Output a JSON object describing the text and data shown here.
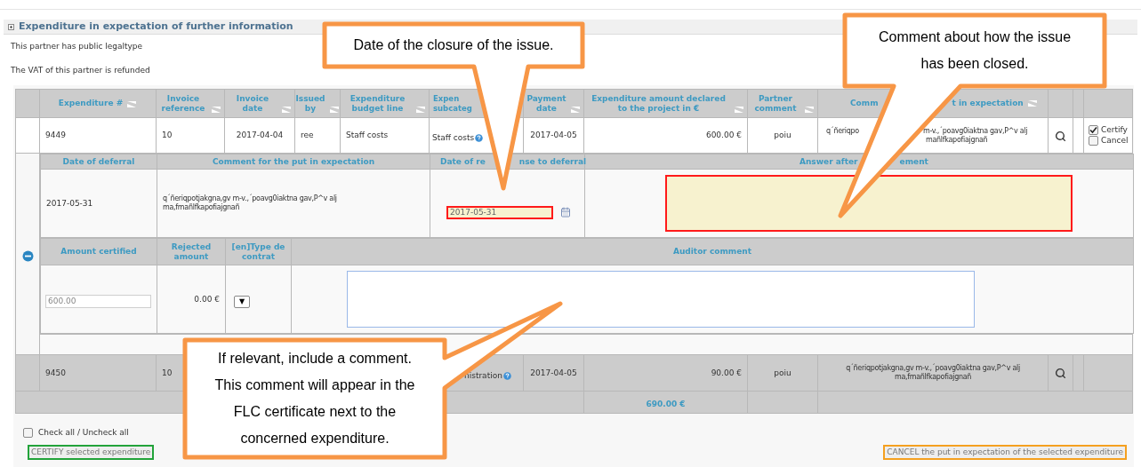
{
  "section": {
    "title": "Expenditure in expectation of further information",
    "expanded": true
  },
  "notes": [
    "This partner has public legaltype",
    "The VAT of this partner is refunded"
  ],
  "table": {
    "columns": [
      {
        "label": "Expenditure #",
        "sort_icon": true
      },
      {
        "label": "Invoice reference",
        "sort_icon": true
      },
      {
        "label": "Invoice date",
        "sort_icon": true
      },
      {
        "label": "Issued by",
        "sort_icon": true
      },
      {
        "label": "Expenditure budget line",
        "sort_icon": true
      },
      {
        "parts": [
          "Expen",
          "subcateg"
        ],
        "sort_icon": false
      },
      {
        "label": "Payment date",
        "sort_icon": true
      },
      {
        "label": "Expenditure amount declared to the project in €",
        "sort_icon": true
      },
      {
        "label": "Partner comment",
        "sort_icon": true
      },
      {
        "parts": [
          "Comm",
          "t in expectation"
        ],
        "sort_icon": true
      }
    ],
    "rows": [
      {
        "expenditure": "9449",
        "invoice_reference": "10",
        "invoice_date": "2017-04-04",
        "issued_by": "ree",
        "budget_line": "Staff costs",
        "subcategory": "Staff costs",
        "payment_date": "2017-04-05",
        "amount": "600.00 €",
        "partner_comment": "poiu",
        "comment_lines": [
          [
            "q´ñeriqpo",
            "m-v.,´poavg0iaktna gav,P^v alj"
          ],
          [
            "mañlfkapofiajgnañ"
          ]
        ],
        "highlighted": false,
        "certify": {
          "label": "Certify",
          "checked": true
        },
        "cancel": {
          "label": "Cancel",
          "checked": false
        },
        "detail": {
          "headers": [
            [
              "Date of deferral"
            ],
            [
              "Comment for the put in expectation"
            ],
            [
              "Date of re",
              "nse to deferral"
            ],
            [
              "Answer after",
              "ement"
            ]
          ],
          "date_of_deferral": "2017-05-31",
          "comment_lines": [
            "q´ñeriqpotjakgna,gv m-v.,´poavg0iaktna gav,P^v alj",
            "ma,fmañlfkapofiajgnañ"
          ],
          "response_date": "2017-05-31"
        },
        "certification": {
          "headers": [
            "Amount certified",
            "Rejected amount",
            "[en]Type de contrat",
            "Auditor comment"
          ],
          "amount_certified": "600.00",
          "rejected_amount": "0.00 €",
          "type_select": "▼"
        }
      },
      {
        "expenditure": "9450",
        "invoice_reference": "10",
        "subcategory": "nistration",
        "payment_date": "2017-04-05",
        "amount": "90.00 €",
        "partner_comment": "poiu",
        "comment_lines": [
          [
            "q´ñeriqpotjakgna,gv m-v.,´poavg0iaktna gav,P^v alj"
          ],
          [
            "ma,fmañlfkapofiajgnañ"
          ]
        ],
        "highlighted": true
      }
    ],
    "total": "690.00 €"
  },
  "check_all": {
    "label": "Check all / Uncheck all",
    "checked": false
  },
  "buttons": [
    {
      "label": "CERTIFY selected expenditure",
      "kind": "certify"
    },
    {
      "label": "CANCEL the put in expectation of the selected expenditure",
      "kind": "cancel"
    }
  ],
  "callouts": [
    {
      "text": "Date of the closure of the issue."
    },
    {
      "text": "Comment about how the issue has been closed."
    },
    {
      "text": "If relevant, include a comment. This comment will appear in the FLC certificate next to the concerned expenditure."
    }
  ]
}
